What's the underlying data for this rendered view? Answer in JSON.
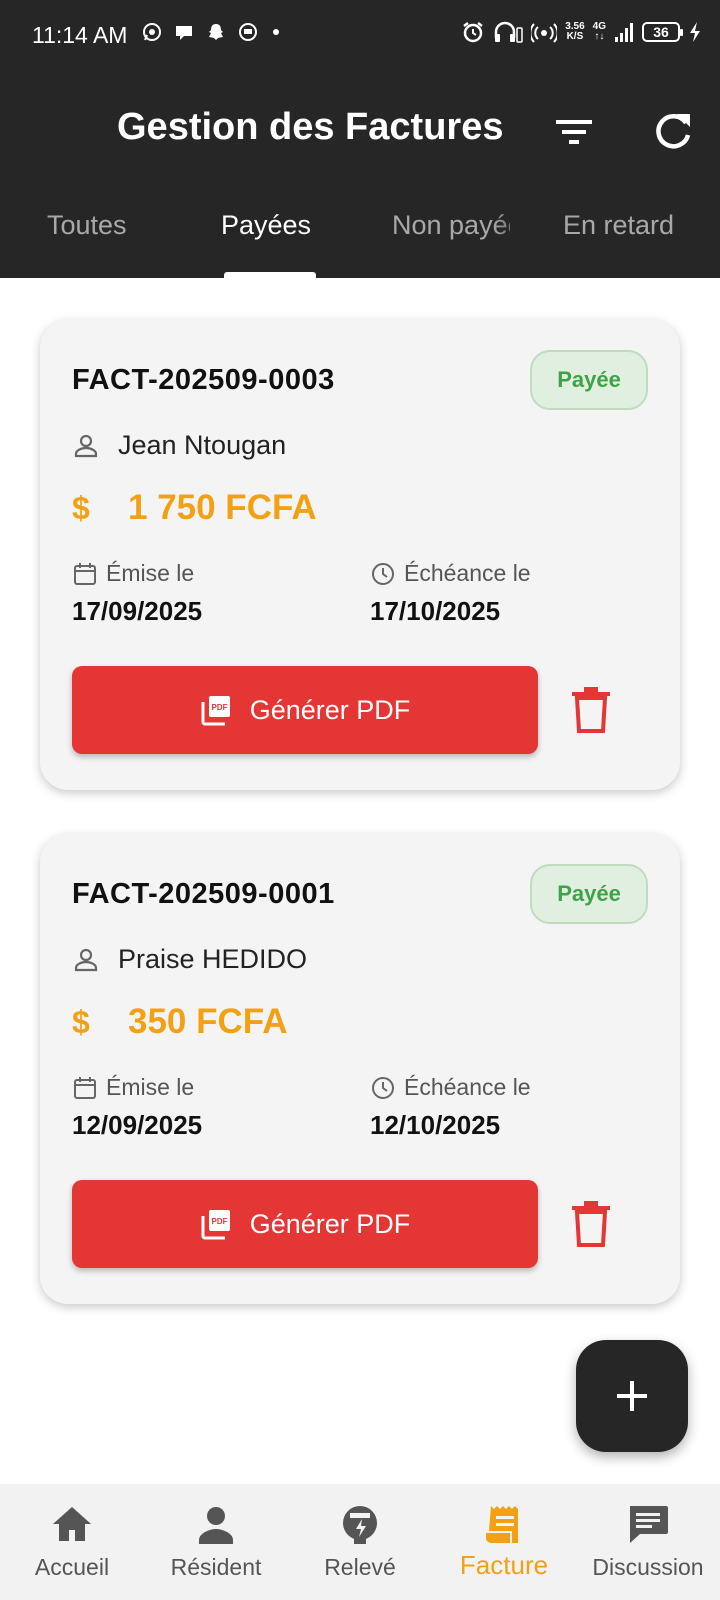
{
  "status_bar": {
    "time": "11:14 AM",
    "net_speed": "3.56",
    "net_speed_unit": "K/S",
    "network": "4G",
    "battery": "36"
  },
  "header": {
    "title": "Gestion des Factures"
  },
  "tabs": [
    {
      "label": "Toutes"
    },
    {
      "label": "Payées",
      "active": true
    },
    {
      "label": "Non payées"
    },
    {
      "label": "En retard"
    }
  ],
  "invoices": [
    {
      "number": "FACT-202509-0003",
      "status": "Payée",
      "client": "Jean Ntougan",
      "currency_symbol": "$",
      "amount": "1 750 FCFA",
      "issued_label": "Émise le",
      "issued_date": "17/09/2025",
      "due_label": "Échéance le",
      "due_date": "17/10/2025",
      "pdf_label": "Générer PDF"
    },
    {
      "number": "FACT-202509-0001",
      "status": "Payée",
      "client": "Praise HEDIDO",
      "currency_symbol": "$",
      "amount": "350 FCFA",
      "issued_label": "Émise le",
      "issued_date": "12/09/2025",
      "due_label": "Échéance le",
      "due_date": "12/10/2025",
      "pdf_label": "Générer PDF"
    }
  ],
  "bottom_nav": [
    {
      "label": "Accueil",
      "icon": "home-icon"
    },
    {
      "label": "Résident",
      "icon": "person-icon"
    },
    {
      "label": "Relevé",
      "icon": "meter-icon"
    },
    {
      "label": "Facture",
      "icon": "receipt-icon",
      "active": true
    },
    {
      "label": "Discussion",
      "icon": "chat-icon"
    }
  ],
  "colors": {
    "header_bg": "#262626",
    "accent": "#f3a114",
    "danger": "#e53636",
    "paid_green": "#3ea347"
  }
}
